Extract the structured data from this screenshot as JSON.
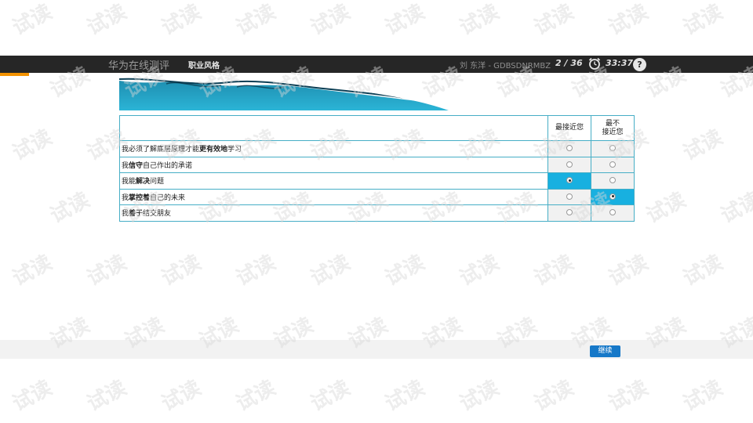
{
  "header": {
    "app_title": "华为在线测评",
    "section_title": "职业风格",
    "user_info": "刘 东洋 - GDBSDNRMBZ",
    "progress": "2 / 36",
    "timer": "33:37",
    "help_label": "?"
  },
  "table": {
    "header_most": "最接近您",
    "header_least_line1": "最不",
    "header_least_line2": "接近您",
    "rows": [
      {
        "pre": "我必须了解底层原理才能",
        "emph": "更有效地",
        "post": "学习",
        "most": false,
        "least": false
      },
      {
        "pre": "我",
        "emph": "信守",
        "post": "自己作出的承诺",
        "most": false,
        "least": false
      },
      {
        "pre": "我能",
        "emph": "解决",
        "post": "问题",
        "most": true,
        "least": false
      },
      {
        "pre": "我",
        "emph": "掌控着",
        "post": "自己的未来",
        "most": false,
        "least": true
      },
      {
        "pre": "我",
        "emph": "善于",
        "post": "结交朋友",
        "most": false,
        "least": false
      }
    ]
  },
  "footer": {
    "continue_label": "继续"
  },
  "watermark": {
    "text": "试读"
  },
  "colors": {
    "header_bg": "#262626",
    "accent_orange": "#f39200",
    "table_border": "#46aec6",
    "selected_cell": "#18b0e0",
    "button_blue": "#1678c8"
  }
}
